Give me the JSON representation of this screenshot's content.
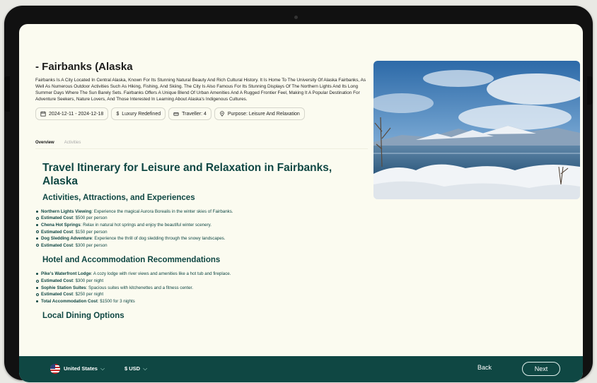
{
  "trip": {
    "title": "- Fairbanks (Alaska",
    "description": "Fairbanks Is A City Located In Central Alaska, Known For Its Stunning Natural Beauty And Rich Cultural History. It Is Home To The University Of Alaska Fairbanks, As Well As Numerous Outdoor Activities Such As Hiking, Fishing, And Skiing. The City Is Also Famous For Its Stunning Displays Of The Northern Lights And Its Long Summer Days Where The Sun Barely Sets. Fairbanks Offers A Unique Blend Of Urban Amenities And A Rugged Frontier Feel, Making It A Popular Destination For Adventure Seekers, Nature Lovers, And Those Interested In Learning About Alaska's Indigenous Cultures.",
    "chips": {
      "dates": "2024-12-11 - 2024-12-18",
      "budget": "Luxury Redefined",
      "travellers": "Traveller: 4",
      "purpose": "Purpose: Leisure And Relaxation"
    }
  },
  "tabs": {
    "overview": "Overview",
    "activities": "Activities"
  },
  "itinerary": {
    "title": "Travel Itinerary for Leisure and Relaxation in Fairbanks, Alaska",
    "sections": [
      {
        "heading": "Activities, Attractions, and Experiences",
        "items": [
          {
            "bold": "Northern Lights Viewing",
            "text": ": Experience the magical Aurora Borealis in the winter skies of Fairbanks."
          },
          {
            "bold": "Estimated Cost",
            "text": ": $500 per person"
          },
          {
            "bold": "Chena Hot Springs",
            "text": ": Relax in natural hot springs and enjoy the beautiful winter scenery."
          },
          {
            "bold": "Estimated Cost",
            "text": ": $150 per person"
          },
          {
            "bold": "Dog Sledding Adventure",
            "text": ": Experience the thrill of dog sledding through the snowy landscapes."
          },
          {
            "bold": "Estimated Cost",
            "text": ": $300 per person"
          }
        ]
      },
      {
        "heading": "Hotel and Accommodation Recommendations",
        "items": [
          {
            "bold": "Pike's Waterfront Lodge",
            "text": ": A cozy lodge with river views and amenities like a hot tub and fireplace."
          },
          {
            "bold": "Estimated Cost",
            "text": ": $300 per night"
          },
          {
            "bold": "Sophie Station Suites",
            "text": ": Spacious suites with kitchenettes and a fitness center."
          },
          {
            "bold": "Estimated Cost",
            "text": ": $250 per night"
          },
          {
            "bold": "Total Accommodation Cost",
            "text": ": $1500 for 3 nights"
          }
        ]
      },
      {
        "heading": "Local Dining Options",
        "items": []
      }
    ]
  },
  "footer": {
    "country": "United States",
    "currency": "$ USD",
    "back_label": "Back",
    "next_label": "Next"
  },
  "colors": {
    "brand": "#0f4743",
    "background": "#fbfbf0"
  },
  "icons": [
    "calendar-icon",
    "dollar-icon",
    "traveller-icon",
    "location-pin-icon",
    "us-flag-icon",
    "chevron-down-icon"
  ]
}
